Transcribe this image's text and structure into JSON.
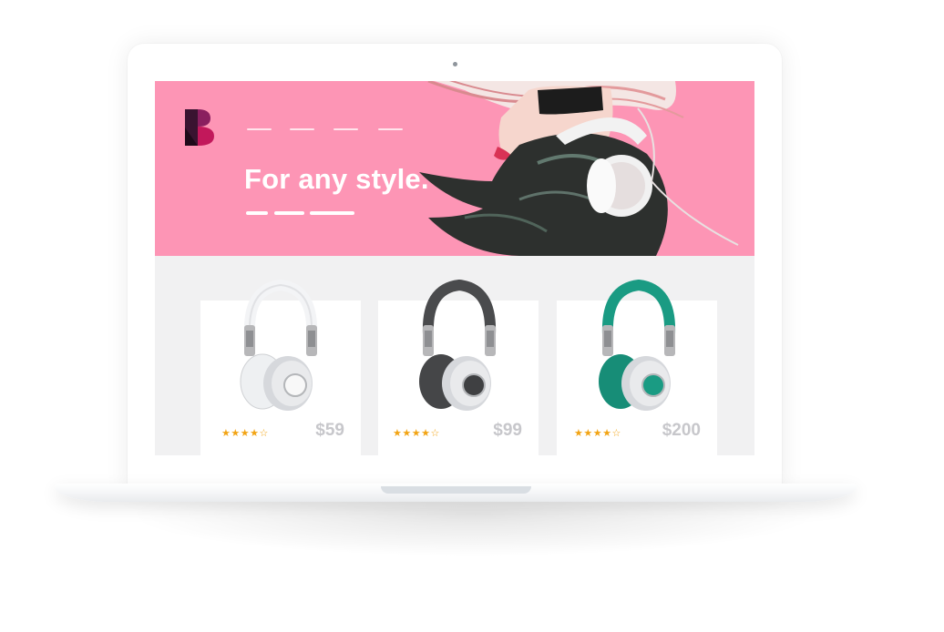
{
  "hero": {
    "headline": "For any style.",
    "nav_count": 4,
    "logo_icon": "b-monogram-icon",
    "background_color": "#fd95b5"
  },
  "products": [
    {
      "name_icon": "white-headphones-icon",
      "rating_stars": "★★★★☆",
      "rating_value": 4,
      "price": "$59",
      "color": "#f3f4f6"
    },
    {
      "name_icon": "black-headphones-icon",
      "rating_stars": "★★★★☆",
      "rating_value": 4,
      "price": "$99",
      "color": "#4a4b4d"
    },
    {
      "name_icon": "teal-headphones-icon",
      "rating_stars": "★★★★☆",
      "rating_value": 4,
      "price": "$200",
      "color": "#1a9b83"
    }
  ],
  "colors": {
    "star": "#f2a414",
    "price": "#c7c7cb"
  }
}
